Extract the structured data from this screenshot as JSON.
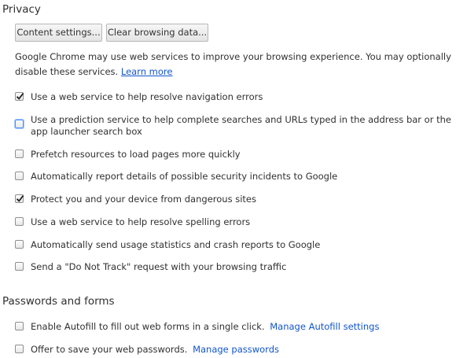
{
  "privacy": {
    "title": "Privacy",
    "content_settings_label": "Content settings...",
    "clear_browsing_label": "Clear browsing data...",
    "description": "Google Chrome may use web services to improve your browsing experience. You may optionally disable these services.",
    "learn_more": "Learn more",
    "options": [
      {
        "label": "Use a web service to help resolve navigation errors",
        "checked": true
      },
      {
        "label": "Use a prediction service to help complete searches and URLs typed in the address bar or the app launcher search box",
        "checked": false
      },
      {
        "label": "Prefetch resources to load pages more quickly",
        "checked": false
      },
      {
        "label": "Automatically report details of possible security incidents to Google",
        "checked": false
      },
      {
        "label": "Protect you and your device from dangerous sites",
        "checked": true
      },
      {
        "label": "Use a web service to help resolve spelling errors",
        "checked": false
      },
      {
        "label": "Automatically send usage statistics and crash reports to Google",
        "checked": false
      },
      {
        "label": "Send a \"Do Not Track\" request with your browsing traffic",
        "checked": false
      }
    ]
  },
  "passwords": {
    "title": "Passwords and forms",
    "options": [
      {
        "label": "Enable Autofill to fill out web forms in a single click.",
        "link": "Manage Autofill settings",
        "checked": false
      },
      {
        "label": "Offer to save your web passwords.",
        "link": "Manage passwords",
        "checked": false
      }
    ]
  },
  "colors": {
    "link": "#1155cc",
    "focus": "#4d90fe"
  }
}
